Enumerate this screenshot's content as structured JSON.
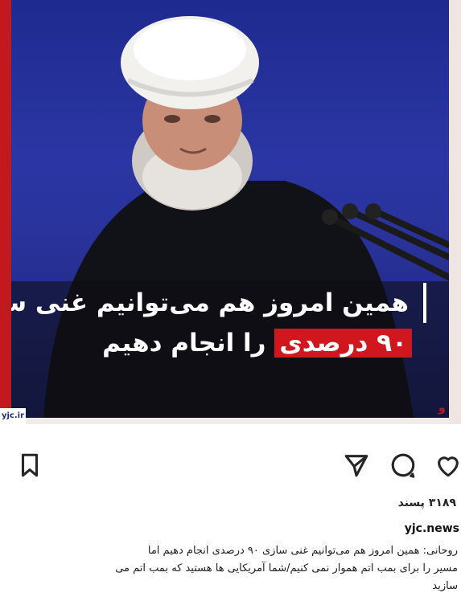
{
  "post": {
    "watermark": "yjc.ir",
    "corner_mark": "و",
    "headline_line1": "همین امروز هم می‌توانیم غنی سازی",
    "headline_highlight": "۹۰ درصدی",
    "headline_line2_rest": " را انجام دهیم"
  },
  "actions": {
    "like_icon": "heart-icon",
    "comment_icon": "comment-icon",
    "share_icon": "send-icon",
    "save_icon": "bookmark-icon"
  },
  "meta": {
    "likes": "۳۱۸۹ پسند",
    "account": "yjc.news",
    "caption_line1": "روحانی: همین امروز هم می‌توانیم غنی سازی ۹۰ درصدی انجام دهیم اما",
    "caption_line2": "مسیر را برای بمب اتم هموار نمی کنیم/شما آمریکایی ها هستید که بمب اتم می",
    "caption_line3": "سازید"
  },
  "colors": {
    "brand_red": "#c2191f",
    "bg_blue": "#2a339c"
  }
}
